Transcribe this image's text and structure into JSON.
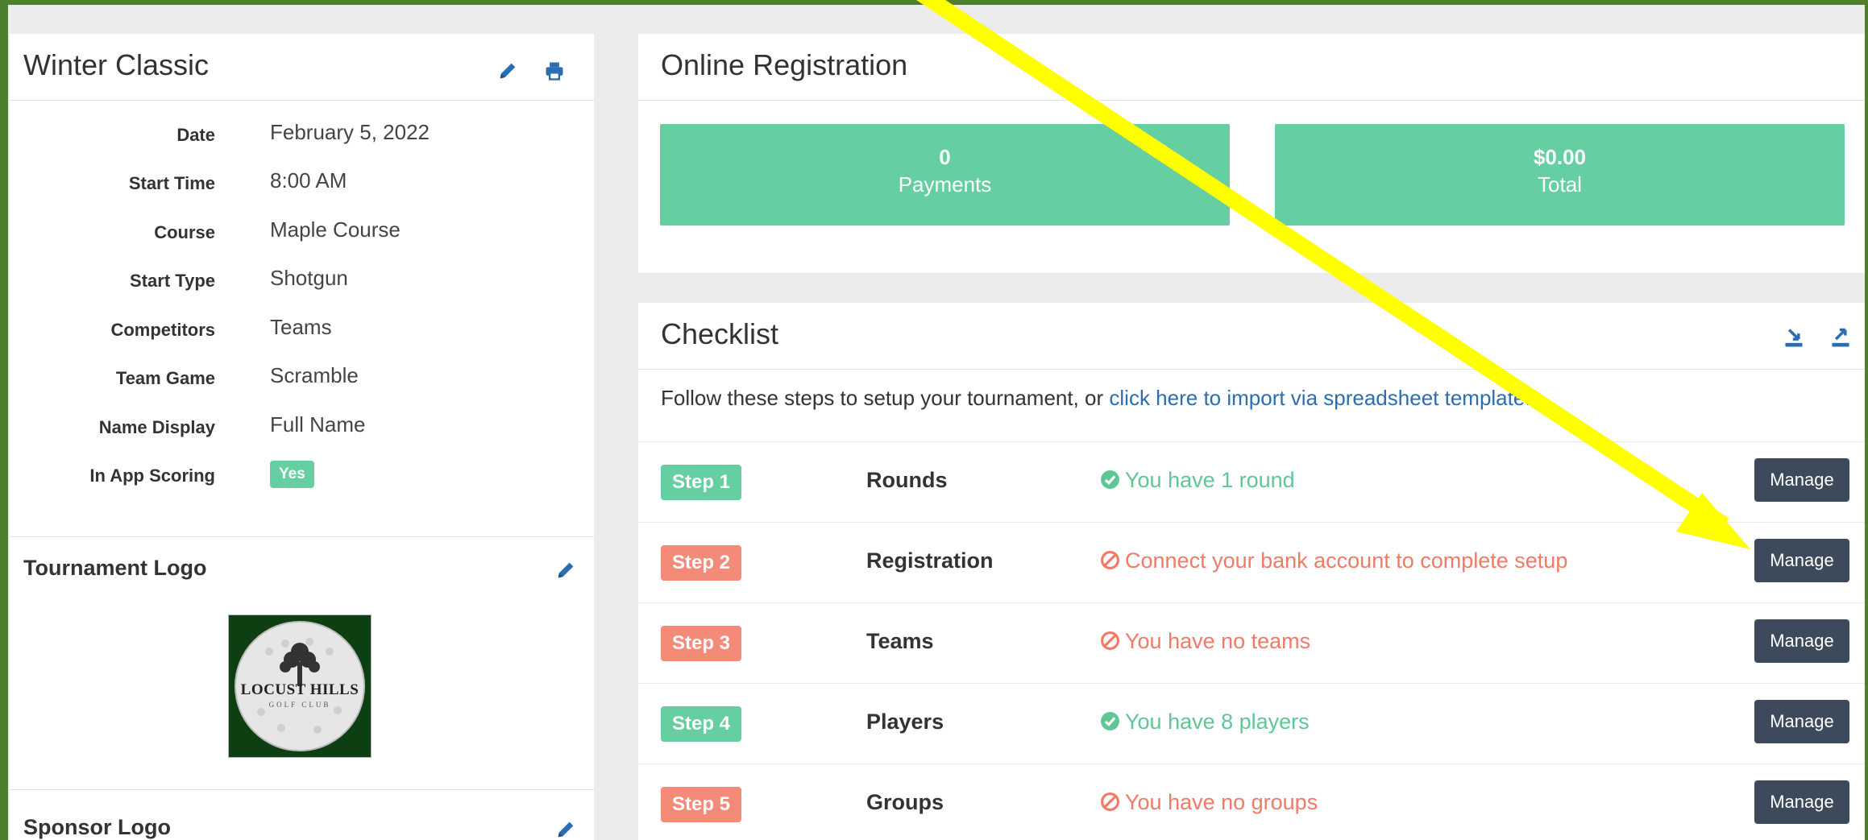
{
  "event": {
    "title": "Winter Classic",
    "edit_icon": "pencil-icon",
    "print_icon": "print-icon"
  },
  "details": [
    {
      "label": "Date",
      "value": "February 5, 2022"
    },
    {
      "label": "Start Time",
      "value": "8:00 AM"
    },
    {
      "label": "Course",
      "value": "Maple Course"
    },
    {
      "label": "Start Type",
      "value": "Shotgun"
    },
    {
      "label": "Competitors",
      "value": "Teams"
    },
    {
      "label": "Team Game",
      "value": "Scramble"
    },
    {
      "label": "Name Display",
      "value": "Full Name"
    },
    {
      "label": "In App Scoring",
      "badge": "Yes"
    }
  ],
  "tournament_logo": {
    "title": "Tournament Logo",
    "logo_text": "LOCUST HILLS",
    "logo_subtext": "GOLF CLUB"
  },
  "sponsor_logo": {
    "title": "Sponsor Logo"
  },
  "online_registration": {
    "title": "Online Registration",
    "tiles": [
      {
        "value": "0",
        "label": "Payments"
      },
      {
        "value": "$0.00",
        "label": "Total"
      }
    ]
  },
  "checklist": {
    "title": "Checklist",
    "intro": "Follow these steps to setup your tournament, or ",
    "intro_link": "click here to import via spreadsheet template.",
    "steps": [
      {
        "badge": "Step 1",
        "name": "Rounds",
        "status": "You have 1 round",
        "state": "ok",
        "button": "Manage"
      },
      {
        "badge": "Step 2",
        "name": "Registration",
        "status": "Connect your bank account to complete setup",
        "state": "error",
        "button": "Manage"
      },
      {
        "badge": "Step 3",
        "name": "Teams",
        "status": "You have no teams",
        "state": "error",
        "button": "Manage"
      },
      {
        "badge": "Step 4",
        "name": "Players",
        "status": "You have 8 players",
        "state": "ok",
        "button": "Manage"
      },
      {
        "badge": "Step 5",
        "name": "Groups",
        "status": "You have no groups",
        "state": "error",
        "button": "Manage"
      }
    ]
  },
  "colors": {
    "frame": "#4e7f2d",
    "success": "#66cfa2",
    "danger": "#f48b79",
    "button": "#3d4a5c",
    "link": "#2a6db0",
    "annotation_arrow": "#ffff00"
  }
}
